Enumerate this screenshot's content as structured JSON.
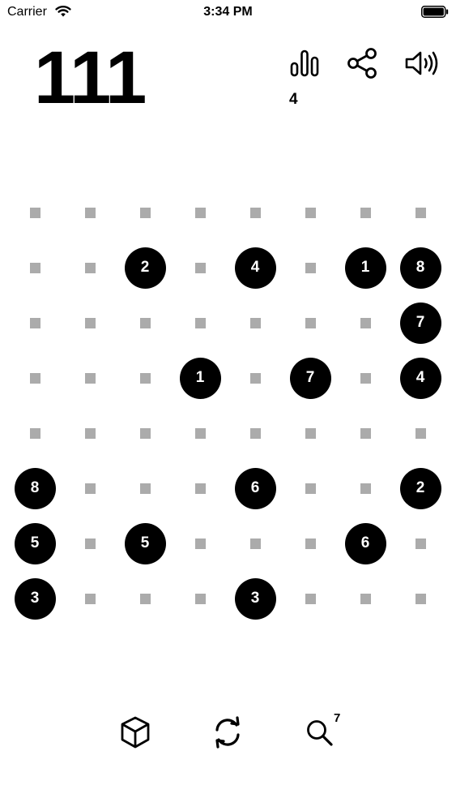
{
  "status_bar": {
    "carrier": "Carrier",
    "time": "3:34 PM",
    "wifi_icon": "wifi-icon",
    "battery_icon": "battery-icon"
  },
  "header": {
    "score": "111",
    "stats_icon": "bar-chart-icon",
    "stats_count": "4",
    "share_icon": "share-icon",
    "sound_icon": "speaker-icon"
  },
  "board": {
    "columns": 8,
    "rows": 8,
    "empty_color": "#ababab",
    "tile_color": "#000000",
    "tile_text_color": "#ffffff",
    "cells": [
      [
        null,
        null,
        null,
        null,
        null,
        null,
        null,
        null
      ],
      [
        null,
        null,
        "2",
        null,
        "4",
        null,
        "1",
        "8"
      ],
      [
        null,
        null,
        null,
        null,
        null,
        null,
        null,
        "7"
      ],
      [
        null,
        null,
        null,
        "1",
        null,
        "7",
        null,
        "4"
      ],
      [
        null,
        null,
        null,
        null,
        null,
        null,
        null,
        null
      ],
      [
        "8",
        null,
        null,
        null,
        "6",
        null,
        null,
        "2"
      ],
      [
        "5",
        null,
        "5",
        null,
        null,
        null,
        "6",
        null
      ],
      [
        "3",
        null,
        null,
        null,
        "3",
        null,
        null,
        null
      ]
    ]
  },
  "toolbar": {
    "cube_icon": "cube-icon",
    "refresh_icon": "refresh-icon",
    "hint_icon": "magnifier-icon",
    "hint_count": "7"
  }
}
